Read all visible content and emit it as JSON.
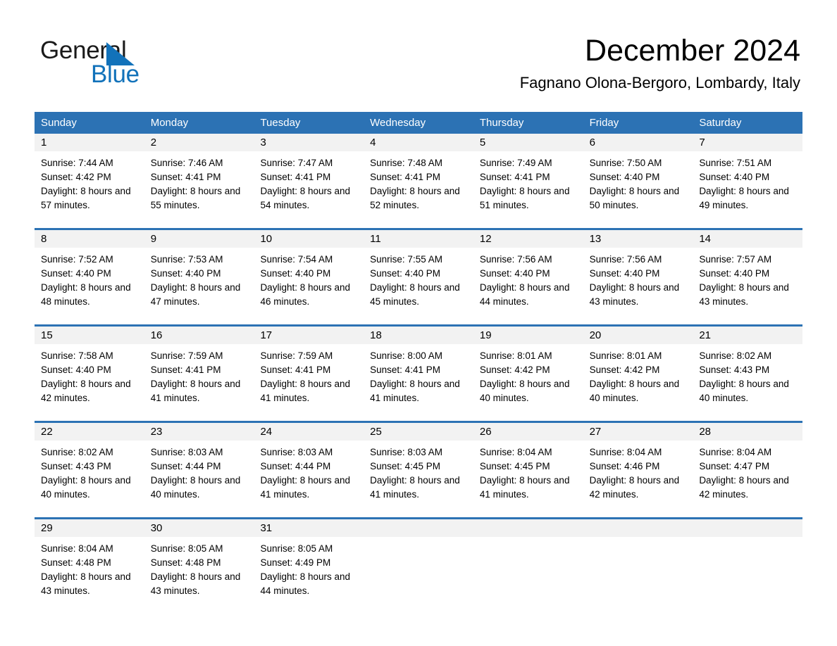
{
  "brand": {
    "name_part1": "General",
    "name_part2": "Blue",
    "logo_icon": "triangle-logo-icon",
    "primary_color": "#1272BA"
  },
  "header": {
    "month_title": "December 2024",
    "location": "Fagnano Olona-Bergoro, Lombardy, Italy"
  },
  "calendar": {
    "header_color": "#2C72B4",
    "daynum_band_color": "#F2F2F2",
    "weekdays": [
      "Sunday",
      "Monday",
      "Tuesday",
      "Wednesday",
      "Thursday",
      "Friday",
      "Saturday"
    ],
    "weeks": [
      [
        {
          "day": "1",
          "sunrise": "Sunrise: 7:44 AM",
          "sunset": "Sunset: 4:42 PM",
          "daylight": "Daylight: 8 hours and 57 minutes."
        },
        {
          "day": "2",
          "sunrise": "Sunrise: 7:46 AM",
          "sunset": "Sunset: 4:41 PM",
          "daylight": "Daylight: 8 hours and 55 minutes."
        },
        {
          "day": "3",
          "sunrise": "Sunrise: 7:47 AM",
          "sunset": "Sunset: 4:41 PM",
          "daylight": "Daylight: 8 hours and 54 minutes."
        },
        {
          "day": "4",
          "sunrise": "Sunrise: 7:48 AM",
          "sunset": "Sunset: 4:41 PM",
          "daylight": "Daylight: 8 hours and 52 minutes."
        },
        {
          "day": "5",
          "sunrise": "Sunrise: 7:49 AM",
          "sunset": "Sunset: 4:41 PM",
          "daylight": "Daylight: 8 hours and 51 minutes."
        },
        {
          "day": "6",
          "sunrise": "Sunrise: 7:50 AM",
          "sunset": "Sunset: 4:40 PM",
          "daylight": "Daylight: 8 hours and 50 minutes."
        },
        {
          "day": "7",
          "sunrise": "Sunrise: 7:51 AM",
          "sunset": "Sunset: 4:40 PM",
          "daylight": "Daylight: 8 hours and 49 minutes."
        }
      ],
      [
        {
          "day": "8",
          "sunrise": "Sunrise: 7:52 AM",
          "sunset": "Sunset: 4:40 PM",
          "daylight": "Daylight: 8 hours and 48 minutes."
        },
        {
          "day": "9",
          "sunrise": "Sunrise: 7:53 AM",
          "sunset": "Sunset: 4:40 PM",
          "daylight": "Daylight: 8 hours and 47 minutes."
        },
        {
          "day": "10",
          "sunrise": "Sunrise: 7:54 AM",
          "sunset": "Sunset: 4:40 PM",
          "daylight": "Daylight: 8 hours and 46 minutes."
        },
        {
          "day": "11",
          "sunrise": "Sunrise: 7:55 AM",
          "sunset": "Sunset: 4:40 PM",
          "daylight": "Daylight: 8 hours and 45 minutes."
        },
        {
          "day": "12",
          "sunrise": "Sunrise: 7:56 AM",
          "sunset": "Sunset: 4:40 PM",
          "daylight": "Daylight: 8 hours and 44 minutes."
        },
        {
          "day": "13",
          "sunrise": "Sunrise: 7:56 AM",
          "sunset": "Sunset: 4:40 PM",
          "daylight": "Daylight: 8 hours and 43 minutes."
        },
        {
          "day": "14",
          "sunrise": "Sunrise: 7:57 AM",
          "sunset": "Sunset: 4:40 PM",
          "daylight": "Daylight: 8 hours and 43 minutes."
        }
      ],
      [
        {
          "day": "15",
          "sunrise": "Sunrise: 7:58 AM",
          "sunset": "Sunset: 4:40 PM",
          "daylight": "Daylight: 8 hours and 42 minutes."
        },
        {
          "day": "16",
          "sunrise": "Sunrise: 7:59 AM",
          "sunset": "Sunset: 4:41 PM",
          "daylight": "Daylight: 8 hours and 41 minutes."
        },
        {
          "day": "17",
          "sunrise": "Sunrise: 7:59 AM",
          "sunset": "Sunset: 4:41 PM",
          "daylight": "Daylight: 8 hours and 41 minutes."
        },
        {
          "day": "18",
          "sunrise": "Sunrise: 8:00 AM",
          "sunset": "Sunset: 4:41 PM",
          "daylight": "Daylight: 8 hours and 41 minutes."
        },
        {
          "day": "19",
          "sunrise": "Sunrise: 8:01 AM",
          "sunset": "Sunset: 4:42 PM",
          "daylight": "Daylight: 8 hours and 40 minutes."
        },
        {
          "day": "20",
          "sunrise": "Sunrise: 8:01 AM",
          "sunset": "Sunset: 4:42 PM",
          "daylight": "Daylight: 8 hours and 40 minutes."
        },
        {
          "day": "21",
          "sunrise": "Sunrise: 8:02 AM",
          "sunset": "Sunset: 4:43 PM",
          "daylight": "Daylight: 8 hours and 40 minutes."
        }
      ],
      [
        {
          "day": "22",
          "sunrise": "Sunrise: 8:02 AM",
          "sunset": "Sunset: 4:43 PM",
          "daylight": "Daylight: 8 hours and 40 minutes."
        },
        {
          "day": "23",
          "sunrise": "Sunrise: 8:03 AM",
          "sunset": "Sunset: 4:44 PM",
          "daylight": "Daylight: 8 hours and 40 minutes."
        },
        {
          "day": "24",
          "sunrise": "Sunrise: 8:03 AM",
          "sunset": "Sunset: 4:44 PM",
          "daylight": "Daylight: 8 hours and 41 minutes."
        },
        {
          "day": "25",
          "sunrise": "Sunrise: 8:03 AM",
          "sunset": "Sunset: 4:45 PM",
          "daylight": "Daylight: 8 hours and 41 minutes."
        },
        {
          "day": "26",
          "sunrise": "Sunrise: 8:04 AM",
          "sunset": "Sunset: 4:45 PM",
          "daylight": "Daylight: 8 hours and 41 minutes."
        },
        {
          "day": "27",
          "sunrise": "Sunrise: 8:04 AM",
          "sunset": "Sunset: 4:46 PM",
          "daylight": "Daylight: 8 hours and 42 minutes."
        },
        {
          "day": "28",
          "sunrise": "Sunrise: 8:04 AM",
          "sunset": "Sunset: 4:47 PM",
          "daylight": "Daylight: 8 hours and 42 minutes."
        }
      ],
      [
        {
          "day": "29",
          "sunrise": "Sunrise: 8:04 AM",
          "sunset": "Sunset: 4:48 PM",
          "daylight": "Daylight: 8 hours and 43 minutes."
        },
        {
          "day": "30",
          "sunrise": "Sunrise: 8:05 AM",
          "sunset": "Sunset: 4:48 PM",
          "daylight": "Daylight: 8 hours and 43 minutes."
        },
        {
          "day": "31",
          "sunrise": "Sunrise: 8:05 AM",
          "sunset": "Sunset: 4:49 PM",
          "daylight": "Daylight: 8 hours and 44 minutes."
        },
        {
          "day": "",
          "sunrise": "",
          "sunset": "",
          "daylight": ""
        },
        {
          "day": "",
          "sunrise": "",
          "sunset": "",
          "daylight": ""
        },
        {
          "day": "",
          "sunrise": "",
          "sunset": "",
          "daylight": ""
        },
        {
          "day": "",
          "sunrise": "",
          "sunset": "",
          "daylight": ""
        }
      ]
    ]
  }
}
